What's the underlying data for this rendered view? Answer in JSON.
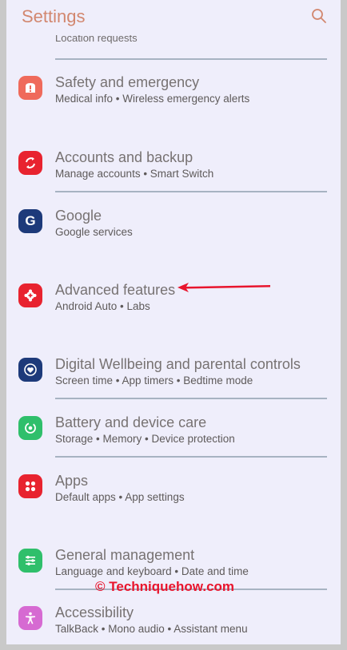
{
  "header": {
    "title": "Settings",
    "search_icon": "search-icon",
    "partial_item": "Location requests"
  },
  "items": [
    {
      "label": "Safety and emergency",
      "sub": "Medical info  •  Wireless emergency alerts",
      "icon": "alert-icon",
      "color": "#ef6a5b"
    },
    {
      "label": "Accounts and backup",
      "sub": "Manage accounts  •  Smart Switch",
      "icon": "sync-icon",
      "color": "#e8232f"
    },
    {
      "label": "Google",
      "sub": "Google services",
      "icon": "google-icon",
      "color": "#1d3a7a"
    },
    {
      "label": "Advanced features",
      "sub": "Android Auto  •  Labs",
      "icon": "gear-plus-icon",
      "color": "#e8232f"
    },
    {
      "label": "Digital Wellbeing and parental controls",
      "sub": "Screen time  •  App timers  •  Bedtime mode",
      "icon": "heart-icon",
      "color": "#1d3a7a"
    },
    {
      "label": "Battery and device care",
      "sub": "Storage  •  Memory  •  Device protection",
      "icon": "refresh-icon",
      "color": "#2fbf6b"
    },
    {
      "label": "Apps",
      "sub": "Default apps  •  App settings",
      "icon": "apps-grid-icon",
      "color": "#e8232f"
    },
    {
      "label": "General management",
      "sub": "Language and keyboard  •  Date and time",
      "icon": "sliders-icon",
      "color": "#2fbf6b"
    },
    {
      "label": "Accessibility",
      "sub": "TalkBack  •  Mono audio  •  Assistant menu",
      "icon": "accessibility-icon",
      "color": "#d66ad2"
    }
  ],
  "watermark": "© Techniquehow.com",
  "colors": {
    "title": "#d2876f",
    "annotation_arrow": "#e8152d",
    "background": "#efeefb"
  }
}
